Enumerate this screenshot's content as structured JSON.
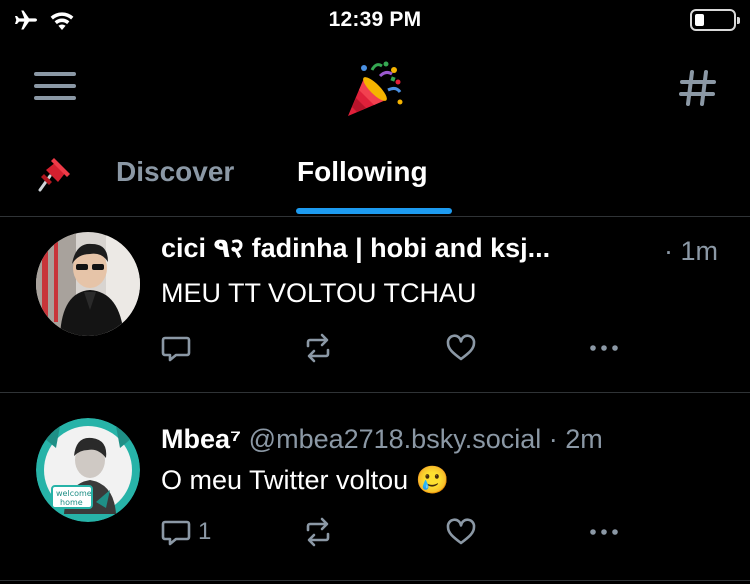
{
  "status_bar": {
    "time": "12:39 PM",
    "icons": [
      "airplane-icon",
      "wifi-icon",
      "battery-icon"
    ]
  },
  "header": {
    "menu_icon": "hamburger-menu-icon",
    "logo_icon": "party-popper-icon",
    "feeds_icon": "hashtag-icon"
  },
  "tabs": {
    "pinned_icon": "pushpin-icon",
    "items": [
      {
        "label": "Discover",
        "active": false
      },
      {
        "label": "Following",
        "active": true
      }
    ]
  },
  "posts": [
    {
      "display_name": "cici ٩२ fadinha |  hobi and ksj...",
      "handle": "",
      "time": "· 1m",
      "text": "MEU TT VOLTOU TCHAU",
      "reply_count": "",
      "actions": [
        "reply-icon",
        "repost-icon",
        "like-icon",
        "more-icon"
      ]
    },
    {
      "display_name": "Mbea⁷",
      "handle": "@mbea2718.bsky.social",
      "time": "· 2m",
      "text": "O meu Twitter voltou",
      "emoji": "🥲",
      "reply_count": "1",
      "actions": [
        "reply-icon",
        "repost-icon",
        "like-icon",
        "more-icon"
      ]
    }
  ],
  "colors": {
    "background": "#000000",
    "muted": "#8b98a5",
    "accent": "#1d9bf0",
    "divider": "#2f3336"
  }
}
